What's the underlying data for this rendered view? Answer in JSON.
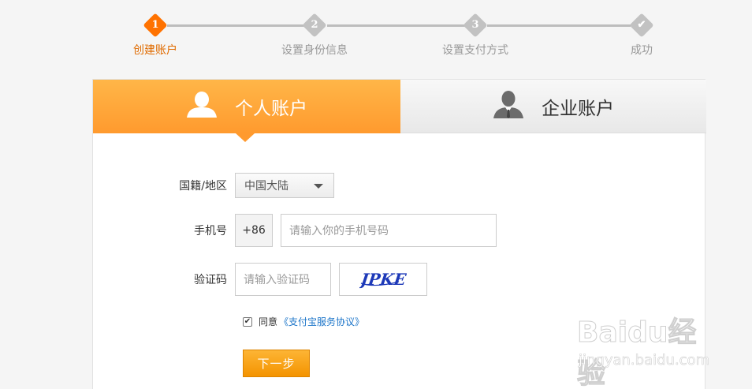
{
  "steps": [
    {
      "num": "1",
      "label": "创建账户"
    },
    {
      "num": "2",
      "label": "设置身份信息"
    },
    {
      "num": "3",
      "label": "设置支付方式"
    },
    {
      "num": "✔",
      "label": "成功"
    }
  ],
  "tabs": {
    "personal": "个人账户",
    "business": "企业账户"
  },
  "form": {
    "nationality_label": "国籍/地区",
    "nationality_value": "中国大陆",
    "phone_label": "手机号",
    "phone_prefix": "+86",
    "phone_placeholder": "请输入你的手机号码",
    "captcha_label": "验证码",
    "captcha_placeholder": "请输入验证码",
    "captcha_text": "JPKE",
    "agree_text": "同意",
    "agree_link": "《支付宝服务协议》",
    "agree_checked": true,
    "next_button": "下一步"
  },
  "colors": {
    "accent": "#ff7200",
    "tab_active": "#ff9a2e",
    "link": "#1c75c9"
  },
  "watermark": {
    "brand": "Baidu经验",
    "url": "jingyan.baidu.com"
  }
}
